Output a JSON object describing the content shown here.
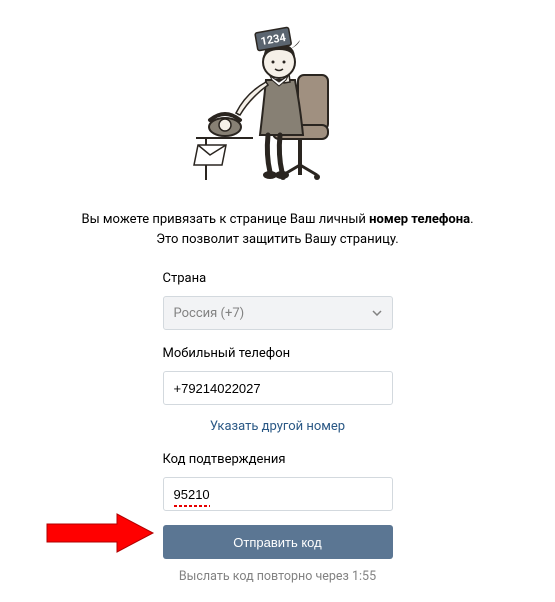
{
  "description": {
    "line1_prefix": "Вы можете привязать к странице Ваш личный ",
    "line1_bold": "номер телефона",
    "line1_suffix": ".",
    "line2": "Это позволит защитить Вашу страницу."
  },
  "form": {
    "country_label": "Страна",
    "country_value": "Россия (+7)",
    "phone_label": "Мобильный телефон",
    "phone_value": "+79214022027",
    "change_number_link": "Указать другой номер",
    "code_label": "Код подтверждения",
    "code_value": "95210",
    "submit_label": "Отправить код",
    "resend_text": "Выслать код повторно через 1:55"
  },
  "illustration": {
    "card_text": "1234"
  }
}
